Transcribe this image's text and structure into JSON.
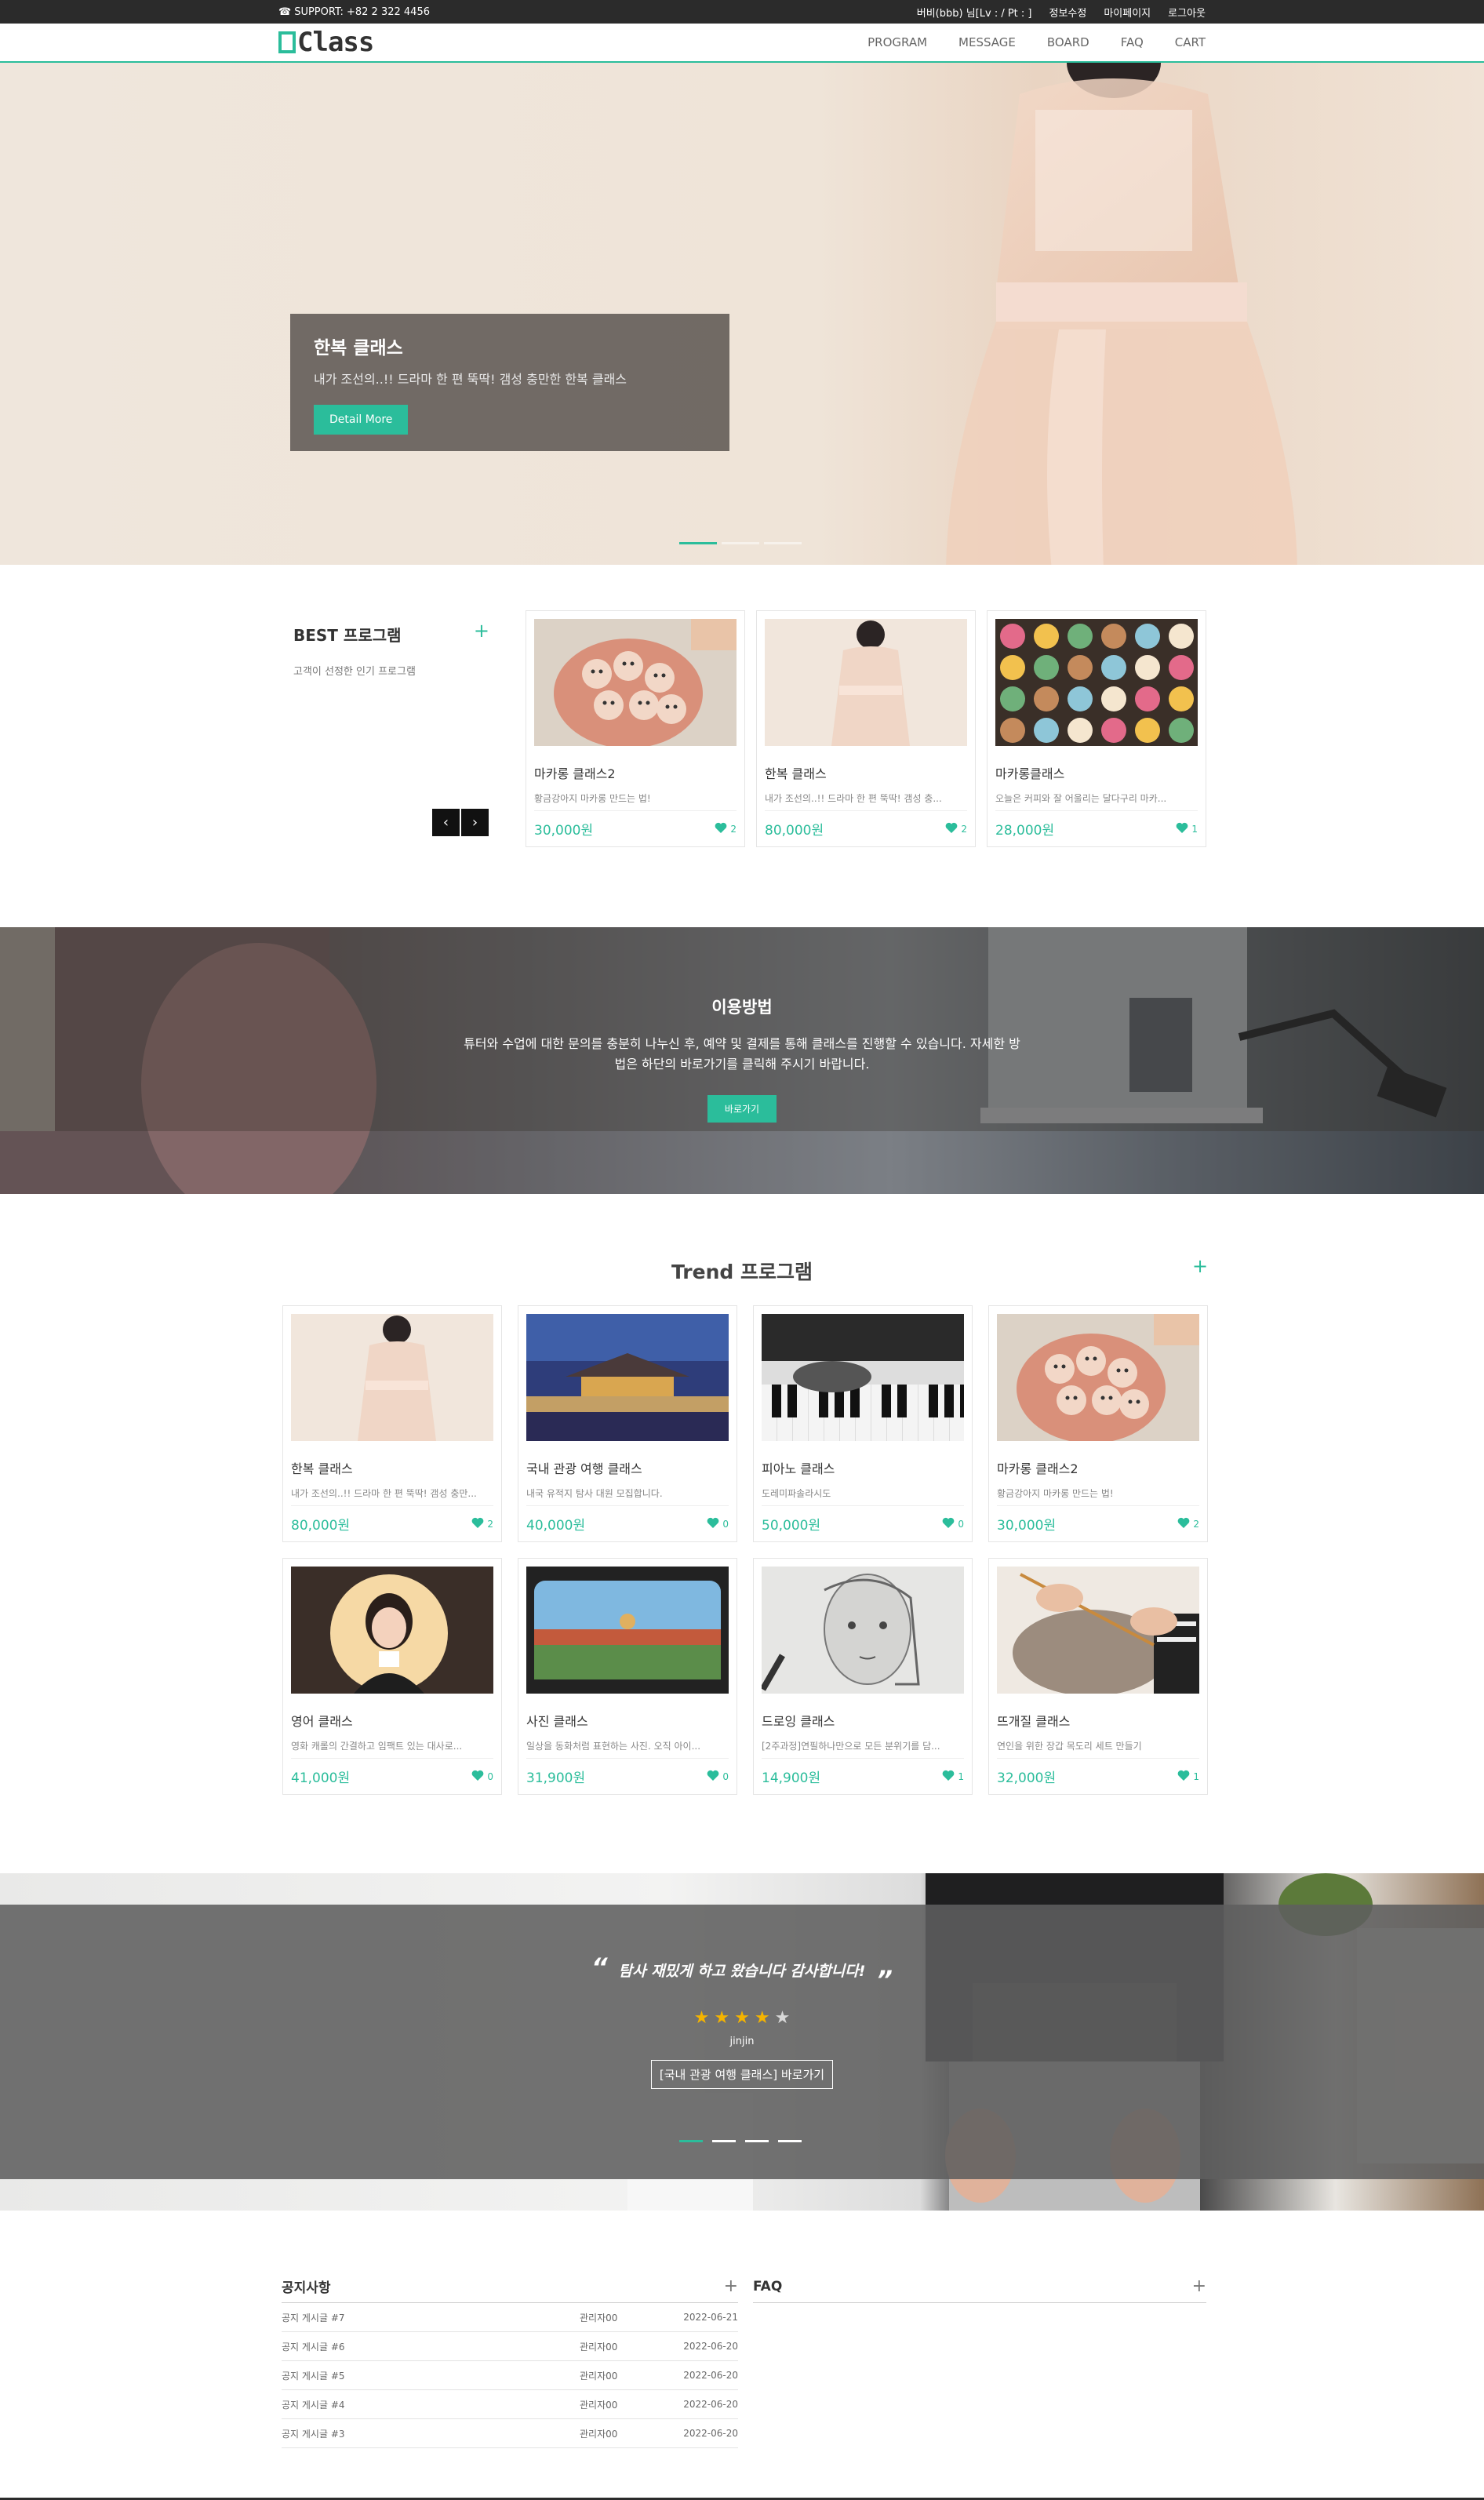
{
  "topbar": {
    "support": "SUPPORT: +82 2 322 4456",
    "links": [
      "버비(bbb) 님[Lv : / Pt : ]",
      "정보수정",
      "마이페이지",
      "로그아웃"
    ]
  },
  "header": {
    "logo": "Class",
    "nav": [
      "PROGRAM",
      "MESSAGE",
      "BOARD",
      "FAQ",
      "CART"
    ]
  },
  "hero": {
    "title": "한복 클래스",
    "subtitle": "내가 조선의..!! 드라마 한 편 뚝딱! 갬성 충만한 한복 클래스",
    "button": "Detail More"
  },
  "best": {
    "title": "BEST 프로그램",
    "plus": "+",
    "subtitle": "고객이 선정한 인기 프로그램",
    "prev": "‹",
    "next": "›",
    "items": [
      {
        "name": "마카롱 클래스2",
        "desc": "황금강아지 마카롱 만드는 법!",
        "price": "30,000원",
        "likes": "2",
        "thumb": "macaron"
      },
      {
        "name": "한복 클래스",
        "desc": "내가 조선의..!! 드라마 한 편 뚝딱! 갬성 충...",
        "price": "80,000원",
        "likes": "2",
        "thumb": "hanbok"
      },
      {
        "name": "마카롱클래스",
        "desc": "오늘은 커피와 잘 어울리는 달다구리 마카...",
        "price": "28,000원",
        "likes": "1",
        "thumb": "macaron-box"
      }
    ]
  },
  "usage": {
    "title": "이용방법",
    "desc": "튜터와 수업에 대한 문의를 충분히 나누신 후, 예약 및 결제를 통해 클래스를 진행할 수 있습니다. 자세한 방법은 하단의 바로가기를 클릭해 주시기 바랍니다.",
    "button": "바로가기"
  },
  "trend": {
    "title": "Trend 프로그램",
    "plus": "+",
    "items": [
      {
        "name": "한복 클래스",
        "desc": "내가 조선의..!! 드라마 한 편 뚝딱! 갬성 충만...",
        "price": "80,000원",
        "likes": "2",
        "thumb": "hanbok"
      },
      {
        "name": "국내 관광 여행 클래스",
        "desc": "내국 유적지 탐사 대원 모집합니다.",
        "price": "40,000원",
        "likes": "0",
        "thumb": "palace"
      },
      {
        "name": "피아노 클래스",
        "desc": "도레미파솔라시도",
        "price": "50,000원",
        "likes": "0",
        "thumb": "piano"
      },
      {
        "name": "마카롱 클래스2",
        "desc": "황금강아지 마카롱 만드는 법!",
        "price": "30,000원",
        "likes": "2",
        "thumb": "macaron"
      },
      {
        "name": "영어 클래스",
        "desc": "영화 캐롤의 간결하고 임팩트 있는 대사로...",
        "price": "41,000원",
        "likes": "0",
        "thumb": "portrait"
      },
      {
        "name": "사진 클래스",
        "desc": "일상을 동화처럼 표현하는 사진. 오직 아이...",
        "price": "31,900원",
        "likes": "0",
        "thumb": "phone"
      },
      {
        "name": "드로잉 클래스",
        "desc": "[2주과정]연필하나만으로 모든 분위기를 담...",
        "price": "14,900원",
        "likes": "1",
        "thumb": "drawing"
      },
      {
        "name": "뜨개질 클래스",
        "desc": "연인을 위한 장갑 목도리 세트 만들기",
        "price": "32,000원",
        "likes": "1",
        "thumb": "knitting"
      }
    ]
  },
  "review": {
    "open_quote": "“",
    "text": "탐사 재밌게 하고 왔습니다 감사합니다!",
    "close_quote": "”",
    "rating": 4,
    "author": "jinjin",
    "link": "[국내 관광 여행 클래스] 바로가기"
  },
  "notice": {
    "title": "공지사항",
    "plus": "+",
    "rows": [
      {
        "title": "공지 게시글 #7",
        "writer": "관리자00",
        "date": "2022-06-21"
      },
      {
        "title": "공지 게시글 #6",
        "writer": "관리자00",
        "date": "2022-06-20"
      },
      {
        "title": "공지 게시글 #5",
        "writer": "관리자00",
        "date": "2022-06-20"
      },
      {
        "title": "공지 게시글 #4",
        "writer": "관리자00",
        "date": "2022-06-20"
      },
      {
        "title": "공지 게시글 #3",
        "writer": "관리자00",
        "date": "2022-06-20"
      }
    ]
  },
  "faq": {
    "title": "FAQ",
    "plus": "+"
  },
  "colors": {
    "accent": "#2bbd9b",
    "topbar": "#2b2b2b"
  }
}
